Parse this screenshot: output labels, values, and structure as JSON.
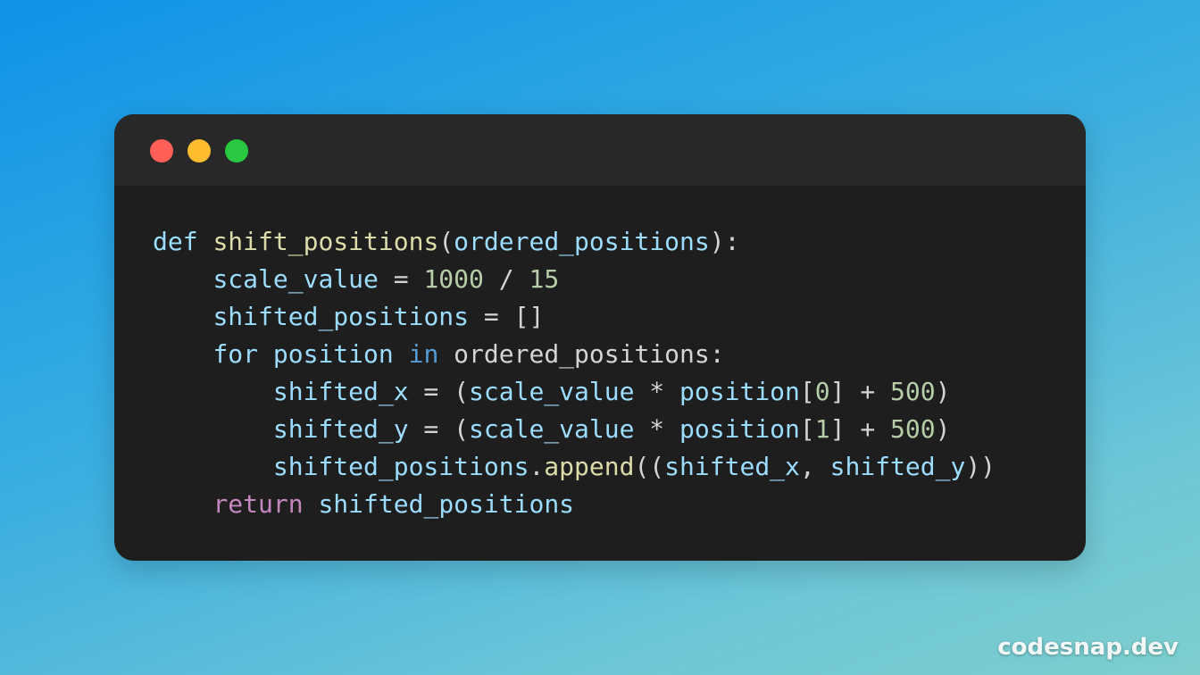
{
  "window": {
    "controls": [
      {
        "name": "close",
        "color": "#ff5f57"
      },
      {
        "name": "minimize",
        "color": "#febc2e"
      },
      {
        "name": "maximize",
        "color": "#28c840"
      }
    ]
  },
  "code": {
    "language": "python",
    "lines": [
      [
        [
          "kw",
          "def"
        ],
        [
          "sp",
          " "
        ],
        [
          "fn",
          "shift_positions"
        ],
        [
          "punc",
          "("
        ],
        [
          "var",
          "ordered_positions"
        ],
        [
          "punc",
          "):"
        ]
      ],
      [
        [
          "sp",
          "    "
        ],
        [
          "var",
          "scale_value"
        ],
        [
          "punc",
          " = "
        ],
        [
          "num",
          "1000"
        ],
        [
          "punc",
          " / "
        ],
        [
          "num",
          "15"
        ]
      ],
      [
        [
          "sp",
          "    "
        ],
        [
          "var",
          "shifted_positions"
        ],
        [
          "punc",
          " = []"
        ]
      ],
      [
        [
          "sp",
          "    "
        ],
        [
          "kw",
          "for"
        ],
        [
          "sp",
          " "
        ],
        [
          "var",
          "position"
        ],
        [
          "sp",
          " "
        ],
        [
          "kw2",
          "in"
        ],
        [
          "sp",
          " "
        ],
        [
          "punc",
          "ordered_positions:"
        ]
      ],
      [
        [
          "sp",
          "        "
        ],
        [
          "var",
          "shifted_x"
        ],
        [
          "punc",
          " = ("
        ],
        [
          "var",
          "scale_value"
        ],
        [
          "punc",
          " * "
        ],
        [
          "var",
          "position"
        ],
        [
          "punc",
          "["
        ],
        [
          "num",
          "0"
        ],
        [
          "punc",
          "] + "
        ],
        [
          "num",
          "500"
        ],
        [
          "punc",
          ")"
        ]
      ],
      [
        [
          "sp",
          "        "
        ],
        [
          "var",
          "shifted_y"
        ],
        [
          "punc",
          " = ("
        ],
        [
          "var",
          "scale_value"
        ],
        [
          "punc",
          " * "
        ],
        [
          "var",
          "position"
        ],
        [
          "punc",
          "["
        ],
        [
          "num",
          "1"
        ],
        [
          "punc",
          "] + "
        ],
        [
          "num",
          "500"
        ],
        [
          "punc",
          ")"
        ]
      ],
      [
        [
          "sp",
          "        "
        ],
        [
          "var",
          "shifted_positions"
        ],
        [
          "punc",
          "."
        ],
        [
          "fn",
          "append"
        ],
        [
          "punc",
          "(("
        ],
        [
          "var",
          "shifted_x"
        ],
        [
          "punc",
          ", "
        ],
        [
          "var",
          "shifted_y"
        ],
        [
          "punc",
          "))"
        ]
      ],
      [
        [
          "sp",
          "    "
        ],
        [
          "ret",
          "return"
        ],
        [
          "sp",
          " "
        ],
        [
          "var",
          "shifted_positions"
        ]
      ]
    ]
  },
  "watermark": "codesnap.dev"
}
